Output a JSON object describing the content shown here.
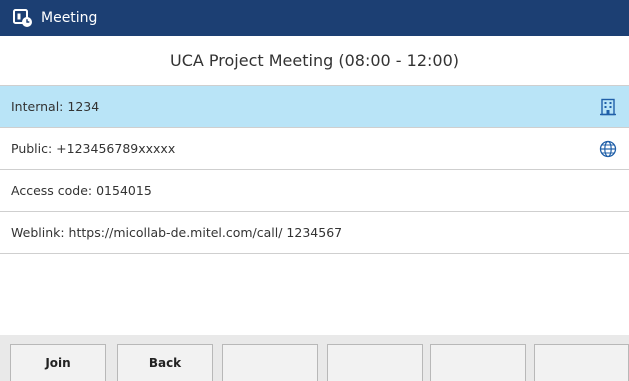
{
  "app": {
    "title": "Meeting"
  },
  "meeting": {
    "title": "UCA Project Meeting (08:00 - 12:00)"
  },
  "details": [
    {
      "label": "Internal: 1234",
      "icon": "building-icon",
      "selected": true
    },
    {
      "label": "Public: +123456789xxxxx",
      "icon": "globe-icon",
      "selected": false
    },
    {
      "label": "Access code: 0154015",
      "icon": "",
      "selected": false
    },
    {
      "label": "Weblink: https://micollab-de.mitel.com/call/ 1234567",
      "icon": "",
      "selected": false
    }
  ],
  "softkeys": [
    "Join",
    "Back",
    "",
    "",
    "",
    ""
  ],
  "colors": {
    "titlebar": "#1c3f73",
    "selected_row": "#b9e4f7",
    "icon": "#1f5fa8"
  }
}
